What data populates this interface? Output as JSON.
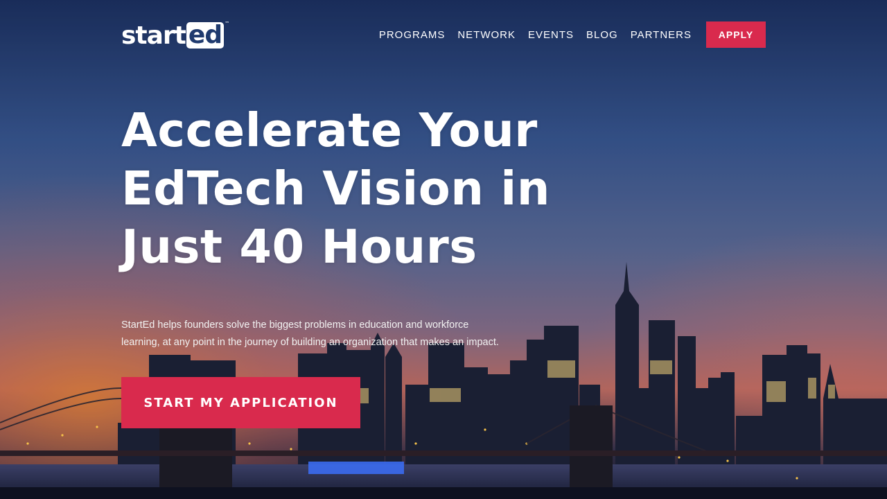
{
  "brand": {
    "logo_main": "start",
    "logo_box": "ed",
    "logo_tm": "™",
    "accent": "#d92a4d"
  },
  "nav": {
    "items": [
      "PROGRAMS",
      "NETWORK",
      "EVENTS",
      "BLOG",
      "PARTNERS"
    ],
    "apply_label": "APPLY"
  },
  "hero": {
    "headline_lines": [
      "Accelerate Your",
      "EdTech Vision in",
      "Just 40 Hours"
    ],
    "subtext_lines": [
      "StartEd helps founders solve the biggest problems in education and workforce",
      "learning, at any point in the journey of building an organization that makes an impact."
    ],
    "cta_label": "START MY APPLICATION"
  }
}
